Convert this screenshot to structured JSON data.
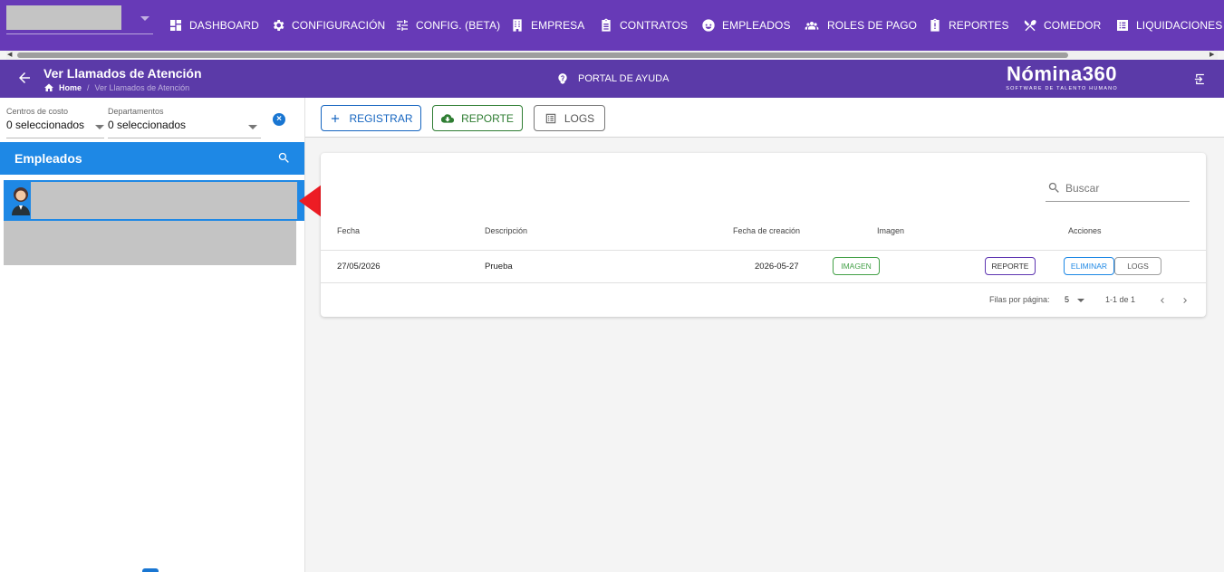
{
  "nav": {
    "items": [
      {
        "label": "DASHBOARD",
        "icon": "dashboard-icon"
      },
      {
        "label": "CONFIGURACIÓN",
        "icon": "gear-icon"
      },
      {
        "label": "CONFIG. (BETA)",
        "icon": "sliders-icon"
      },
      {
        "label": "EMPRESA",
        "icon": "building-icon"
      },
      {
        "label": "CONTRATOS",
        "icon": "clipboard-icon"
      },
      {
        "label": "EMPLEADOS",
        "icon": "face-icon"
      },
      {
        "label": "ROLES DE PAGO",
        "icon": "people-icon"
      },
      {
        "label": "REPORTES",
        "icon": "report-icon"
      },
      {
        "label": "COMEDOR",
        "icon": "utensils-icon"
      },
      {
        "label": "LIQUIDACIONES",
        "icon": "list-icon"
      }
    ]
  },
  "header": {
    "title": "Ver Llamados de Atención",
    "breadcrumb_home": "Home",
    "breadcrumb_sep": "/",
    "breadcrumb_current": "Ver Llamados de Atención",
    "help_label": "PORTAL DE AYUDA",
    "brand_name": "Nómina360",
    "brand_tagline": "SOFTWARE DE TALENTO HUMANO"
  },
  "filters": {
    "cost_centers_label": "Centros de costo",
    "cost_centers_value": "0 seleccionados",
    "departments_label": "Departamentos",
    "departments_value": "0 seleccionados"
  },
  "employees": {
    "title": "Empleados"
  },
  "toolbar": {
    "register_label": "REGISTRAR",
    "report_label": "REPORTE",
    "logs_label": "LOGS"
  },
  "table": {
    "search_placeholder": "Buscar",
    "columns": {
      "fecha": "Fecha",
      "descripcion": "Descripción",
      "fecha_creacion": "Fecha de creación",
      "imagen": "Imagen",
      "acciones": "Acciones"
    },
    "rows": [
      {
        "fecha": "27/05/2026",
        "descripcion": "Prueba",
        "fecha_creacion": "2026-05-27",
        "imagen_btn": "IMAGEN",
        "reporte_btn": "REPORTE",
        "eliminar_btn": "ELIMINAR",
        "logs_btn": "LOGS"
      }
    ],
    "rows_per_page_label": "Filas por página:",
    "rows_per_page_value": "5",
    "page_range": "1-1 de 1"
  },
  "colors": {
    "nav_bg": "#673ab7",
    "subbar_bg": "#5b3aa8",
    "employees_header": "#1e88e5",
    "arrow": "#ed1c24"
  }
}
